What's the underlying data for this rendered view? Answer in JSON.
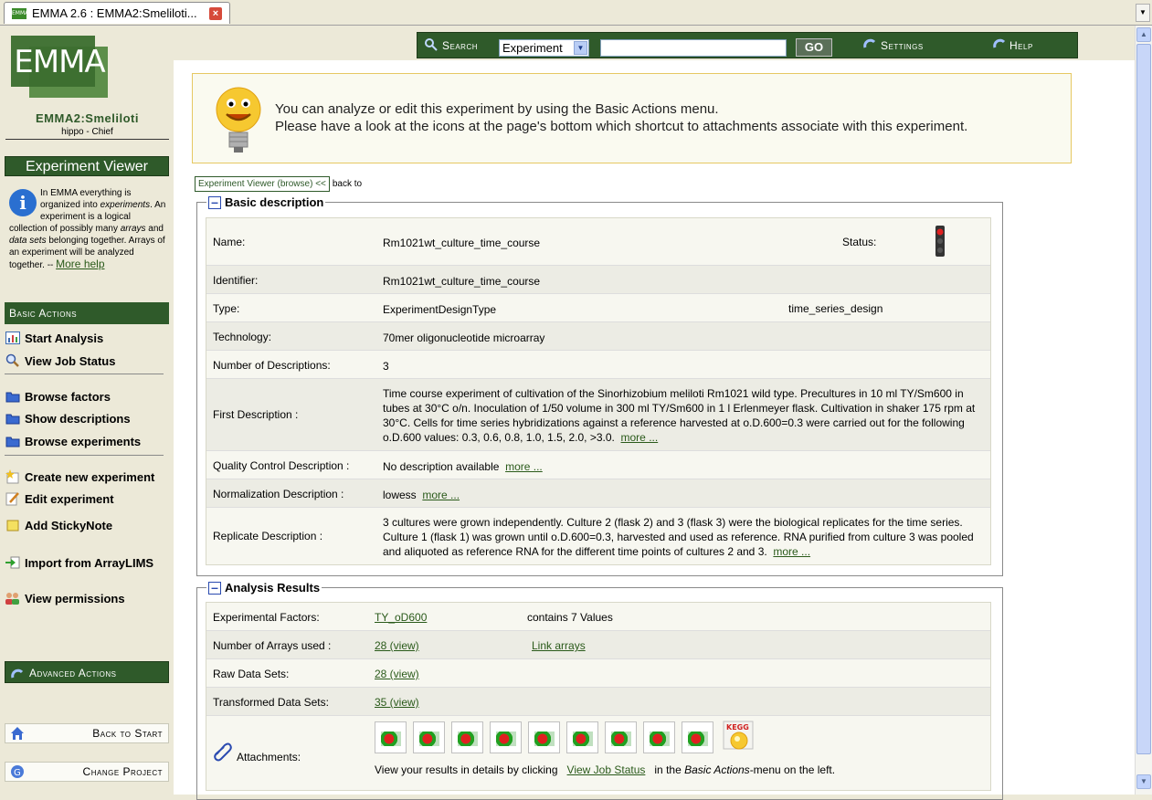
{
  "tab": {
    "title": "EMMA 2.6 : EMMA2:Smeliloti..."
  },
  "sidebar": {
    "logo_text": "EMMA",
    "project": "EMMA2:Smeliloti",
    "user": "hippo - Chief",
    "viewer_title": "Experiment Viewer",
    "info_text_parts": [
      "In EMMA everything is organized into ",
      "experiments",
      ". An experiment is a logical collection of possibly many ",
      "arrays",
      " and ",
      "data sets",
      " belonging together. Arrays of an experiment will be analyzed together. -- "
    ],
    "more_help": "More help",
    "basic_actions_label": "Basic Actions",
    "basic_items": [
      "Start Analysis",
      "View Job Status",
      "Browse factors",
      "Show descriptions",
      "Browse experiments",
      "Create new experiment",
      "Edit experiment",
      "Add StickyNote",
      "Import from ArrayLIMS",
      "View permissions"
    ],
    "advanced_actions_label": "Advanced Actions",
    "back_to_start": "Back to Start",
    "change_project": "Change Project"
  },
  "topbar": {
    "search_label": "Search",
    "search_select": "Experiment",
    "search_value": "",
    "go": "GO",
    "settings": "Settings",
    "help": "Help"
  },
  "hint": {
    "line1": "You can analyze or edit this experiment by using the Basic Actions menu.",
    "line2": "Please have a look at the icons at the page's bottom which shortcut to attachments associate with this experiment."
  },
  "breadcrumb": {
    "current": "Experiment Viewer (browse) <<",
    "back": "back to"
  },
  "basic": {
    "legend": "Basic description",
    "name_label": "Name:",
    "name": "Rm1021wt_culture_time_course",
    "status_label": "Status:",
    "identifier_label": "Identifier:",
    "identifier": "Rm1021wt_culture_time_course",
    "type_label": "Type:",
    "type": "ExperimentDesignType",
    "type_value": "time_series_design",
    "technology_label": "Technology:",
    "technology": "70mer oligonucleotide microarray",
    "num_desc_label": "Number of Descriptions:",
    "num_desc": "3",
    "first_desc_label": "First Description :",
    "first_desc": "Time course experiment of cultivation of the Sinorhizobium meliloti Rm1021 wild type. Precultures in 10 ml TY/Sm600 in tubes at 30°C o/n. Inoculation of 1/50 volume in 300 ml TY/Sm600 in 1 l Erlenmeyer flask. Cultivation in shaker 175 rpm at 30°C. Cells for time series hybridizations against a reference harvested at o.D.600=0.3 were carried out for the following o.D.600 values: 0.3, 0.6, 0.8, 1.0, 1.5, 2.0, >3.0.",
    "qc_label": "Quality Control Description :",
    "qc": "No description available",
    "norm_label": "Normalization Description :",
    "norm": "lowess",
    "rep_label": "Replicate Description :",
    "rep": "3 cultures were grown independently. Culture 2 (flask 2) and 3 (flask 3) were the biological replicates for the time series. Culture 1 (flask 1) was grown until o.D.600=0.3, harvested and used as reference. RNA purified from culture 3 was pooled and aliquoted as reference RNA for the different time points of cultures 2 and 3.",
    "more": "more ..."
  },
  "analysis": {
    "legend": "Analysis Results",
    "factors_label": "Experimental Factors:",
    "factors_link": "TY_oD600",
    "factors_info": "contains 7 Values",
    "arrays_label": "Number of Arrays used :",
    "arrays_link": "28 (view)",
    "arrays_link2": "Link arrays",
    "raw_label": "Raw Data Sets:",
    "raw_link": "28 (view)",
    "trans_label": "Transformed Data Sets:",
    "trans_link": "35 (view)",
    "attach_label": "Attachments:",
    "attach_text1": "View your results in details by clicking",
    "attach_link": "View Job Status",
    "attach_text2": "in the",
    "attach_text3": "Basic Actions",
    "attach_text4": "-menu on the left."
  }
}
